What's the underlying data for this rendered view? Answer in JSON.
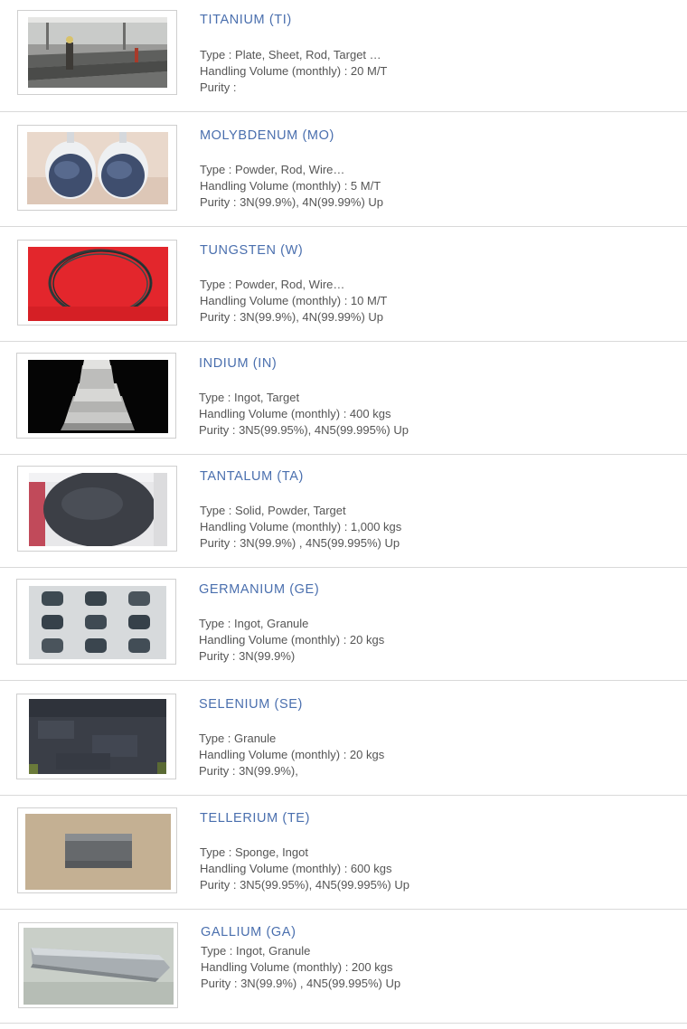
{
  "materials": [
    {
      "name": "TITANIUM (TI)",
      "image": "titanium-plates-photo",
      "type": "Type : Plate, Sheet, Rod, Target …",
      "volume": "Handling Volume (monthly) : 20 M/T",
      "purity": "Purity :"
    },
    {
      "name": "MOLYBDENUM (MO)",
      "image": "molybdenum-powder-photo",
      "type": "Type : Powder, Rod, Wire…",
      "volume": "Handling Volume (monthly) : 5 M/T",
      "purity": "Purity : 3N(99.9%), 4N(99.99%) Up"
    },
    {
      "name": "TUNGSTEN (W)",
      "image": "tungsten-wire-photo",
      "type": "Type : Powder, Rod, Wire…",
      "volume": "Handling Volume (monthly) : 10 M/T",
      "purity": "Purity : 3N(99.9%), 4N(99.99%) Up"
    },
    {
      "name": "INDIUM (IN)",
      "image": "indium-ingot-photo",
      "type": "Type : Ingot, Target",
      "volume": "Handling Volume (monthly) : 400 kgs",
      "purity": "Purity : 3N5(99.95%), 4N5(99.995%) Up"
    },
    {
      "name": "TANTALUM (TA)",
      "image": "tantalum-disc-photo",
      "type": "Type : Solid, Powder, Target",
      "volume": "Handling Volume (monthly) : 1,000 kgs",
      "purity": "Purity : 3N(99.9%) , 4N5(99.995%) Up"
    },
    {
      "name": "GERMANIUM (GE)",
      "image": "germanium-ingots-photo",
      "type": "Type : Ingot, Granule",
      "volume": "Handling Volume (monthly) : 20 kgs",
      "purity": "Purity : 3N(99.9%)"
    },
    {
      "name": "SELENIUM (SE)",
      "image": "selenium-granules-photo",
      "type": "Type : Granule",
      "volume": "Handling Volume (monthly) : 20 kgs",
      "purity": "Purity : 3N(99.9%),"
    },
    {
      "name": "TELLERIUM (TE)",
      "image": "tellurium-ingot-photo",
      "type": "Type : Sponge, Ingot",
      "volume": "Handling Volume (monthly) : 600 kgs",
      "purity": "Purity : 3N5(99.95%), 4N5(99.995%) Up"
    },
    {
      "name": "GALLIUM (GA)",
      "image": "gallium-bar-photo",
      "type": "Type : Ingot, Granule",
      "volume": "Handling Volume (monthly) : 200 kgs",
      "purity": "Purity : 3N(99.9%) , 4N5(99.995%) Up"
    }
  ]
}
